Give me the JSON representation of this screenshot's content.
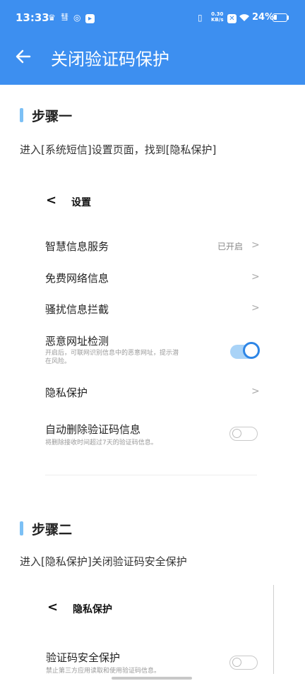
{
  "status_bar": {
    "time": "13:33",
    "net_speed_value": "0.30",
    "net_speed_unit": "KB/s",
    "battery": "24%"
  },
  "header": {
    "title": "关闭验证码保护",
    "color": "#3d8ff0"
  },
  "step1": {
    "title": "步骤一",
    "desc": "进入[系统短信]设置页面，找到[隐私保护]",
    "screenshot": {
      "back": "<",
      "title": "设置",
      "rows": [
        {
          "label": "智慧信息服务",
          "value": "已开启",
          "icon": "chevron-right-icon"
        },
        {
          "label": "免费网络信息",
          "icon": "chevron-right-icon"
        },
        {
          "label": "骚扰信息拦截",
          "icon": "chevron-right-icon"
        },
        {
          "label": "恶意网址检测",
          "sub1": "开启后，可联网识别信息中的恶意网址，提示潜",
          "sub2": "在风险。",
          "toggle": "on"
        },
        {
          "label": "隐私保护",
          "icon": "chevron-right-icon"
        },
        {
          "label": "自动删除验证码信息",
          "sub1": "将删除接收时间超过7天的验证码信息。",
          "toggle": "off"
        }
      ]
    }
  },
  "step2": {
    "title": "步骤二",
    "desc": "进入[隐私保护]关闭验证码安全保护",
    "screenshot": {
      "back": "<",
      "title": "隐私保护",
      "rows": [
        {
          "label": "验证码安全保护",
          "sub1": "禁止第三方应用读取和使用验证码信息。",
          "toggle": "off"
        }
      ]
    }
  }
}
